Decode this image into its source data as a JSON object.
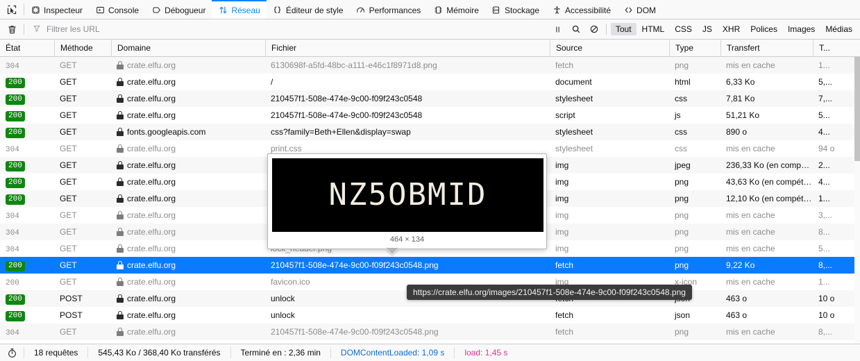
{
  "toolbox": {
    "picker_icon": "element-picker-icon",
    "tabs": [
      {
        "label": "Inspecteur",
        "icon": "inspector-icon",
        "selected": false
      },
      {
        "label": "Console",
        "icon": "console-icon",
        "selected": false
      },
      {
        "label": "Débogueur",
        "icon": "debugger-icon",
        "selected": false
      },
      {
        "label": "Réseau",
        "icon": "network-icon",
        "selected": true
      },
      {
        "label": "Éditeur de style",
        "icon": "style-editor-icon",
        "selected": false
      },
      {
        "label": "Performances",
        "icon": "performance-icon",
        "selected": false
      },
      {
        "label": "Mémoire",
        "icon": "memory-icon",
        "selected": false
      },
      {
        "label": "Stockage",
        "icon": "storage-icon",
        "selected": false
      },
      {
        "label": "Accessibilité",
        "icon": "accessibility-icon",
        "selected": false
      },
      {
        "label": "DOM",
        "icon": "dom-icon",
        "selected": false
      }
    ]
  },
  "filterbar": {
    "clear_icon": "trash-icon",
    "filter_icon": "funnel-icon",
    "filter_placeholder": "Filtrer les URL",
    "filter_value": "",
    "pause_icon": "pause-icon",
    "search_icon": "search-icon",
    "block_icon": "block-icon",
    "types": [
      {
        "label": "Tout",
        "active": true
      },
      {
        "label": "HTML",
        "active": false
      },
      {
        "label": "CSS",
        "active": false
      },
      {
        "label": "JS",
        "active": false
      },
      {
        "label": "XHR",
        "active": false
      },
      {
        "label": "Polices",
        "active": false
      },
      {
        "label": "Images",
        "active": false
      },
      {
        "label": "Médias",
        "active": false
      }
    ]
  },
  "table": {
    "columns": [
      {
        "key": "state",
        "label": "État"
      },
      {
        "key": "method",
        "label": "Méthode"
      },
      {
        "key": "domain",
        "label": "Domaine"
      },
      {
        "key": "file",
        "label": "Fichier"
      },
      {
        "key": "source",
        "label": "Source"
      },
      {
        "key": "type",
        "label": "Type"
      },
      {
        "key": "transfer",
        "label": "Transfert"
      },
      {
        "key": "time",
        "label": "T..."
      }
    ],
    "rows": [
      {
        "state": "304",
        "method": "GET",
        "domain": "crate.elfu.org",
        "file": "6130698f-a5fd-48bc-a111-e46c1f8971d8.png",
        "source": "fetch",
        "type": "png",
        "transfer": "mis en cache",
        "time": "1...",
        "cached": true,
        "selected": false
      },
      {
        "state": "200",
        "method": "GET",
        "domain": "crate.elfu.org",
        "file": "/",
        "source": "document",
        "type": "html",
        "transfer": "6,33 Ko",
        "time": "5,...",
        "cached": false,
        "selected": false
      },
      {
        "state": "200",
        "method": "GET",
        "domain": "crate.elfu.org",
        "file": "210457f1-508e-474e-9c00-f09f243c0548",
        "source": "stylesheet",
        "type": "css",
        "transfer": "7,81 Ko",
        "time": "7,...",
        "cached": false,
        "selected": false
      },
      {
        "state": "200",
        "method": "GET",
        "domain": "crate.elfu.org",
        "file": "210457f1-508e-474e-9c00-f09f243c0548",
        "source": "script",
        "type": "js",
        "transfer": "51,21 Ko",
        "time": "5...",
        "cached": false,
        "selected": false
      },
      {
        "state": "200",
        "method": "GET",
        "domain": "fonts.googleapis.com",
        "file": "css?family=Beth+Ellen&display=swap",
        "source": "stylesheet",
        "type": "css",
        "transfer": "890 o",
        "time": "4...",
        "cached": false,
        "selected": false
      },
      {
        "state": "304",
        "method": "GET",
        "domain": "crate.elfu.org",
        "file": "print.css",
        "source": "stylesheet",
        "type": "css",
        "transfer": "mis en cache",
        "time": "94 o",
        "cached": true,
        "selected": false
      },
      {
        "state": "200",
        "method": "GET",
        "domain": "crate.elfu.org",
        "file": "",
        "source": "img",
        "type": "jpeg",
        "transfer": "236,33 Ko (en compétition)",
        "time": "2...",
        "cached": false,
        "selected": false
      },
      {
        "state": "200",
        "method": "GET",
        "domain": "crate.elfu.org",
        "file": "",
        "source": "img",
        "type": "png",
        "transfer": "43,63 Ko (en compétition)",
        "time": "4...",
        "cached": false,
        "selected": false
      },
      {
        "state": "200",
        "method": "GET",
        "domain": "crate.elfu.org",
        "file": "",
        "source": "img",
        "type": "png",
        "transfer": "12,10 Ko (en compétition)",
        "time": "1...",
        "cached": false,
        "selected": false
      },
      {
        "state": "304",
        "method": "GET",
        "domain": "crate.elfu.org",
        "file": "",
        "source": "img",
        "type": "png",
        "transfer": "mis en cache",
        "time": "3,...",
        "cached": true,
        "selected": false
      },
      {
        "state": "304",
        "method": "GET",
        "domain": "crate.elfu.org",
        "file": "",
        "source": "img",
        "type": "png",
        "transfer": "mis en cache",
        "time": "8...",
        "cached": true,
        "selected": false
      },
      {
        "state": "304",
        "method": "GET",
        "domain": "crate.elfu.org",
        "file": "lock_header.png",
        "source": "img",
        "type": "png",
        "transfer": "mis en cache",
        "time": "5...",
        "cached": true,
        "selected": false
      },
      {
        "state": "200",
        "method": "GET",
        "domain": "crate.elfu.org",
        "file": "210457f1-508e-474e-9c00-f09f243c0548.png",
        "source": "fetch",
        "type": "png",
        "transfer": "9,22 Ko",
        "time": "8,...",
        "cached": false,
        "selected": true
      },
      {
        "state": "200",
        "method": "GET",
        "domain": "crate.elfu.org",
        "file": "favicon.ico",
        "source": "img",
        "type": "x-icon",
        "transfer": "mis en cache",
        "time": "1...",
        "cached": true,
        "selected": false
      },
      {
        "state": "200",
        "method": "POST",
        "domain": "crate.elfu.org",
        "file": "unlock",
        "source": "fetch",
        "type": "json",
        "transfer": "463 o",
        "time": "10 o",
        "cached": false,
        "selected": false
      },
      {
        "state": "200",
        "method": "POST",
        "domain": "crate.elfu.org",
        "file": "unlock",
        "source": "fetch",
        "type": "json",
        "transfer": "463 o",
        "time": "10 o",
        "cached": false,
        "selected": false
      },
      {
        "state": "304",
        "method": "GET",
        "domain": "crate.elfu.org",
        "file": "210457f1-508e-474e-9c00-f09f243c0548.png",
        "source": "fetch",
        "type": "png",
        "transfer": "mis en cache",
        "time": "8,...",
        "cached": true,
        "selected": false
      }
    ]
  },
  "preview": {
    "image_text": "NZ5OBMID",
    "dimensions": "464 × 134",
    "bg_color": "#000000",
    "text_color": "#f3ece1"
  },
  "url_tooltip": {
    "text": "https://crate.elfu.org/images/210457f1-508e-474e-9c00-f09f243c0548.png"
  },
  "statusbar": {
    "clock_icon": "stopwatch-icon",
    "requests": "18 requêtes",
    "transferred": "545,43 Ko / 368,40 Ko transférés",
    "finished": "Terminé en : 2,36 min",
    "domcontentloaded": "DOMContentLoaded: 1,09 s",
    "load": "load: 1,45 s"
  },
  "colors": {
    "accent": "#0a84ff",
    "selection": "#0a7bfe",
    "status_ok": "#108610",
    "dcl": "#0a6cd8",
    "load": "#e7308c"
  }
}
